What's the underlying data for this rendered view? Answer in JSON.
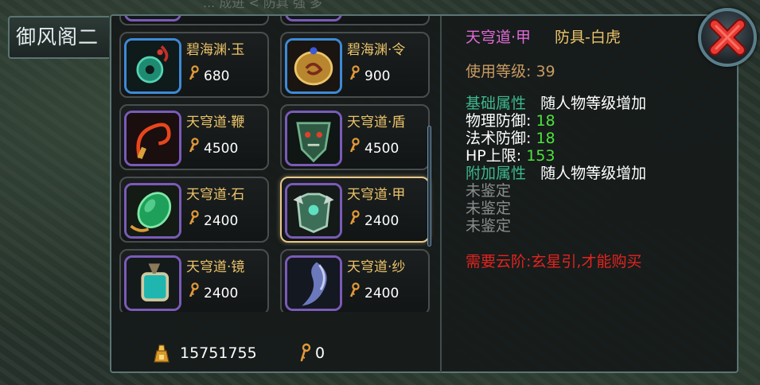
{
  "background": {
    "overlay_text": "... 成进 < 防具 强 多"
  },
  "shop": {
    "tab_title": "御风阁二"
  },
  "items": [
    {
      "name": "",
      "price": "",
      "frame": "purple",
      "art": "blade"
    },
    {
      "name": "",
      "price": "",
      "frame": "purple",
      "art": "necklace"
    },
    {
      "name": "碧海渊·玉",
      "price": "680",
      "frame": "blue",
      "art": "jade"
    },
    {
      "name": "碧海渊·令",
      "price": "900",
      "frame": "blue",
      "art": "token"
    },
    {
      "name": "天穹道·鞭",
      "price": "4500",
      "frame": "purple",
      "art": "whip"
    },
    {
      "name": "天穹道·盾",
      "price": "4500",
      "frame": "purple",
      "art": "shield"
    },
    {
      "name": "天穹道·石",
      "price": "2400",
      "frame": "purple",
      "art": "stone"
    },
    {
      "name": "天穹道·甲",
      "price": "2400",
      "frame": "purple",
      "art": "armor",
      "selected": true
    },
    {
      "name": "天穹道·镜",
      "price": "2400",
      "frame": "purple",
      "art": "mirror"
    },
    {
      "name": "天穹道·纱",
      "price": "2400",
      "frame": "purple",
      "art": "veil"
    }
  ],
  "currency": {
    "gold": "15751755",
    "key": "0"
  },
  "details": {
    "name": "天穹道·甲",
    "type": "防具-白虎",
    "level_label": "使用等级: 39",
    "base_attr_label": "基础属性",
    "base_attr_value": "随人物等级增加",
    "stats": [
      {
        "label": "物理防御: ",
        "value": "18"
      },
      {
        "label": "法术防御: ",
        "value": "18"
      },
      {
        "label": "HP上限: ",
        "value": "153"
      }
    ],
    "extra_attr_label": "附加属性",
    "extra_attr_value": "随人物等级增加",
    "unidentified": [
      "未鉴定",
      "未鉴定",
      "未鉴定"
    ],
    "requirement": "需要云阶:玄星引,才能购买"
  },
  "colors": {
    "item_name": "#ecc46a",
    "detail_name": "#e06ad6",
    "stat_value": "#4ee23c",
    "attr_label": "#3db88f",
    "requirement": "#e3231e",
    "frame_purple": "#7a5bb8",
    "frame_blue": "#3e8ad6"
  },
  "icons": {
    "close": "close-x-icon",
    "gold": "gold-ingot-icon",
    "key": "key-currency-icon"
  }
}
